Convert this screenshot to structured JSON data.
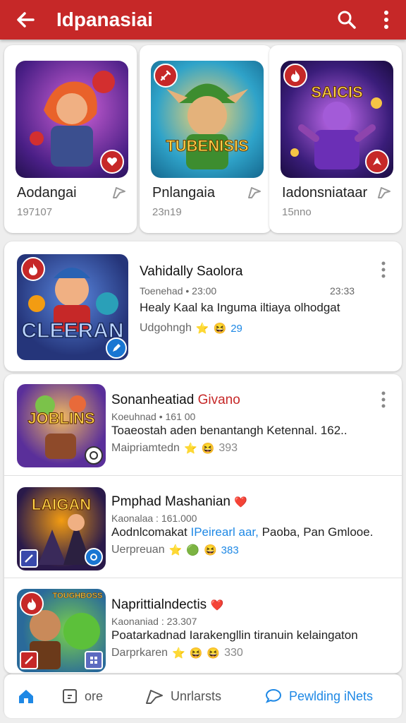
{
  "header": {
    "title": "Idpanasiai",
    "back_icon": "back-arrow-icon",
    "search_icon": "search-icon",
    "menu_icon": "more-vert-icon",
    "bg_color": "#c62828"
  },
  "featured": [
    {
      "name": "Aodangai",
      "count": "197107"
    },
    {
      "name": "Pnlangaia",
      "count": "23n19"
    },
    {
      "name": "Iadonsniataar",
      "count": "15nno"
    }
  ],
  "featured_art_text": {
    "second": "TUBENISIS",
    "third": "SAICIS"
  },
  "top_item": {
    "art_text": "CLEERAN",
    "title": "Vahidally Saolora",
    "meta": "Toenehad • 23:00",
    "time": "23:33",
    "desc": "Healy Kaal ka Inguma iltiaya olhodgat",
    "foot": "Udgohngh",
    "foot_count": "29"
  },
  "list_items": [
    {
      "art_text": "JOBLINS",
      "title": "Sonanheatiad",
      "title_accent": "Givano",
      "meta": "Koeuhnad • 161 00",
      "desc": "Toaeostah aden benantangh Ketennal. 162..",
      "foot": "Maipriamtedn",
      "foot_count": "393"
    },
    {
      "art_text": "LAIGAN",
      "title": "Pmphad Mashanian",
      "meta": "Kaonalaa : 161.000",
      "desc_a": "Aodnlcomakat",
      "desc_b": "IPeirearl aar,",
      "desc_c": "Paoba, Pan Gmlooe.",
      "foot": "Uerpreuan",
      "foot_count": "383"
    },
    {
      "art_text": "TOUGHBOSS",
      "title": "Naprittialndectis",
      "meta": "Kaonaniad : 23.307",
      "desc": "Poatarkadnad Iarakengllin tiranuin kelaingaton",
      "foot": "Darprkaren",
      "foot_count": "330"
    }
  ],
  "bottom_nav": [
    {
      "label": "",
      "icon": "home-icon"
    },
    {
      "label": "ore",
      "icon": "clipboard-icon"
    },
    {
      "label": "Unrlarsts",
      "icon": "share-icon"
    },
    {
      "label": "Pewlding iNets",
      "icon": "chat-bubble-icon"
    }
  ],
  "colors": {
    "accent": "#c62828",
    "link": "#1e88e5"
  }
}
